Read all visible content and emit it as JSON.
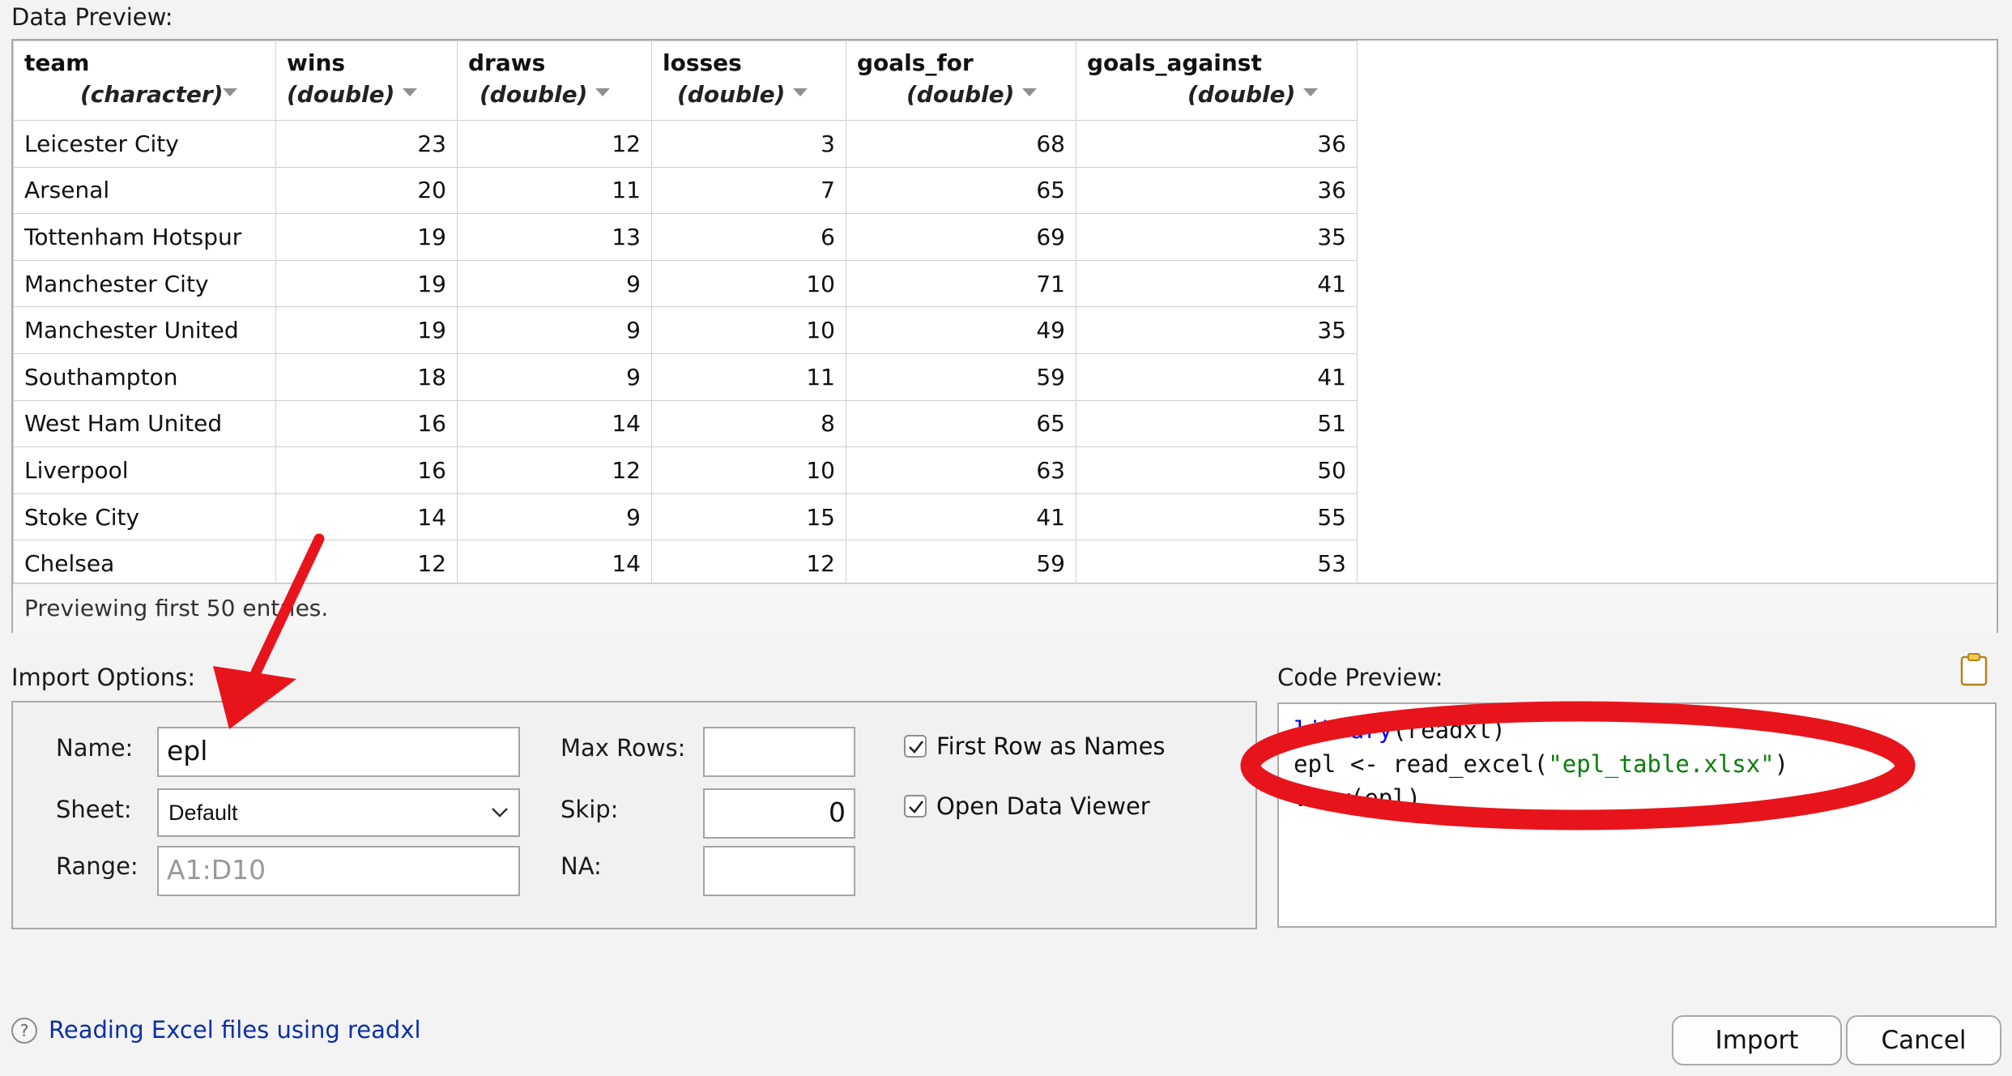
{
  "data_preview": {
    "label": "Data Preview:",
    "columns": [
      {
        "name": "team",
        "type": "(character)"
      },
      {
        "name": "wins",
        "type": "(double)"
      },
      {
        "name": "draws",
        "type": "(double)"
      },
      {
        "name": "losses",
        "type": "(double)"
      },
      {
        "name": "goals_for",
        "type": "(double)"
      },
      {
        "name": "goals_against",
        "type": "(double)"
      }
    ],
    "rows": [
      [
        "Leicester City",
        "23",
        "12",
        "3",
        "68",
        "36"
      ],
      [
        "Arsenal",
        "20",
        "11",
        "7",
        "65",
        "36"
      ],
      [
        "Tottenham Hotspur",
        "19",
        "13",
        "6",
        "69",
        "35"
      ],
      [
        "Manchester City",
        "19",
        "9",
        "10",
        "71",
        "41"
      ],
      [
        "Manchester United",
        "19",
        "9",
        "10",
        "49",
        "35"
      ],
      [
        "Southampton",
        "18",
        "9",
        "11",
        "59",
        "41"
      ],
      [
        "West Ham United",
        "16",
        "14",
        "8",
        "65",
        "51"
      ],
      [
        "Liverpool",
        "16",
        "12",
        "10",
        "63",
        "50"
      ],
      [
        "Stoke City",
        "14",
        "9",
        "15",
        "41",
        "55"
      ],
      [
        "Chelsea",
        "12",
        "14",
        "12",
        "59",
        "53"
      ]
    ],
    "footer": "Previewing first 50 entries."
  },
  "import_options": {
    "label": "Import Options:",
    "name_label": "Name:",
    "name_value": "epl",
    "sheet_label": "Sheet:",
    "sheet_value": "Default",
    "range_label": "Range:",
    "range_placeholder": "A1:D10",
    "max_rows_label": "Max Rows:",
    "max_rows_value": "",
    "skip_label": "Skip:",
    "skip_value": "0",
    "na_label": "NA:",
    "na_value": "",
    "first_row_label": "First Row as Names",
    "first_row_checked": true,
    "open_viewer_label": "Open Data Viewer",
    "open_viewer_checked": true
  },
  "code_preview": {
    "label": "Code Preview:",
    "line1_fn": "library",
    "line1_rest": "(readxl)",
    "line2_pre": "epl <- read_excel(",
    "line2_str": "\"epl_table.xlsx\"",
    "line2_post": ")",
    "line3": "View(epl)"
  },
  "help": {
    "icon": "?",
    "link": "Reading Excel files using readxl"
  },
  "buttons": {
    "import": "Import",
    "cancel": "Cancel"
  },
  "colors": {
    "annotation_red": "#e8141c",
    "link_blue": "#0b2fa6",
    "keyword_blue": "#0000ff",
    "string_green": "#0a7d0a"
  }
}
